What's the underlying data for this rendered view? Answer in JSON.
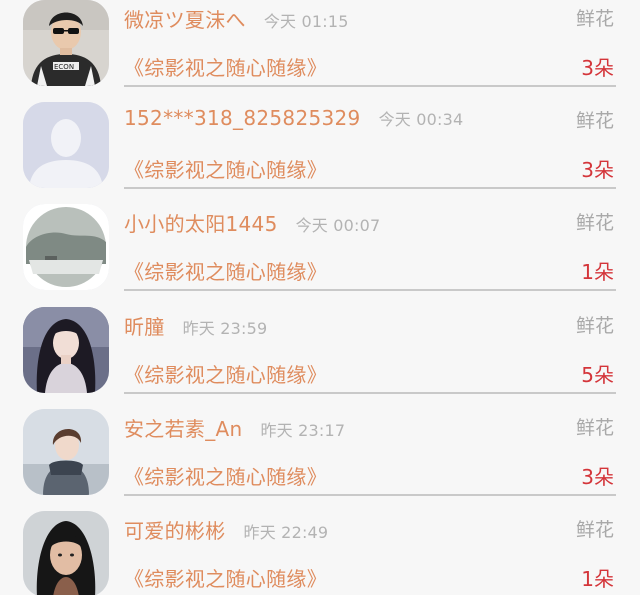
{
  "rows": [
    {
      "name": "微凉ツ夏沫へ",
      "time": "今天 01:15",
      "gift": "鲜花",
      "work": "《综影视之随心随缘》",
      "count": "3朵",
      "avatar": "photo-sunglasses-man"
    },
    {
      "name": "152***318_825825329",
      "time": "今天 00:34",
      "gift": "鲜花",
      "work": "《综影视之随心随缘》",
      "count": "3朵",
      "avatar": "default-person-icon"
    },
    {
      "name": "小小的太阳1445",
      "time": "今天 00:07",
      "gift": "鲜花",
      "work": "《综影视之随心随缘》",
      "count": "1朵",
      "avatar": "photo-foggy-landscape"
    },
    {
      "name": "昕朣",
      "time": "昨天 23:59",
      "gift": "鲜花",
      "work": "《综影视之随心随缘》",
      "count": "5朵",
      "avatar": "illustration-dark-hair-girl"
    },
    {
      "name": "安之若素_An",
      "time": "昨天 23:17",
      "gift": "鲜花",
      "work": "《综影视之随心随缘》",
      "count": "3朵",
      "avatar": "photo-scarf-girl"
    },
    {
      "name": "可爱的彬彬",
      "time": "昨天 22:49",
      "gift": "鲜花",
      "work": "《综影视之随心随缘》",
      "count": "1朵",
      "avatar": "photo-girl-headphones"
    }
  ],
  "colors": {
    "name": "#df8c5e",
    "time": "#b3b3b3",
    "gift": "#a9a9a9",
    "count": "#d4353a",
    "divider": "#c9c9c9",
    "background": "#f7f7f7"
  }
}
